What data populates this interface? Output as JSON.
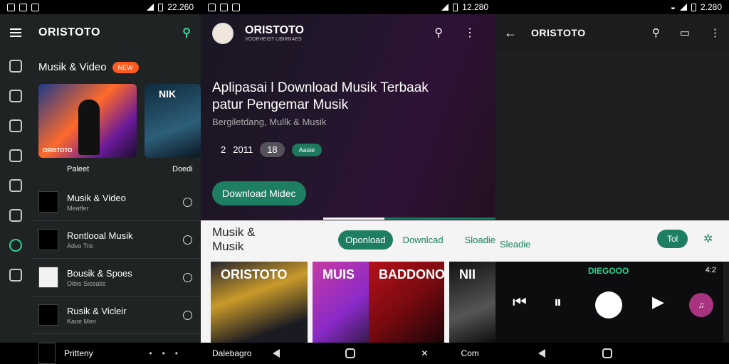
{
  "panel1": {
    "status": {
      "time": "22.260"
    },
    "header": {
      "brand": "ORISTOTO"
    },
    "section": {
      "title": "Musik & Video",
      "badge": "NEW"
    },
    "cards": [
      {
        "caption": "ORISTOTO",
        "under_label": "Paleet"
      },
      {
        "title": "NIK",
        "under_label": "Doedi"
      }
    ],
    "list": [
      {
        "title": "Musik & Video",
        "subtitle": "Meatfer"
      },
      {
        "title": "Rontlooal Musik",
        "subtitle": "Advo Tric"
      },
      {
        "title": "Bousik & Spoes",
        "subtitle": "Oibis Siceatis"
      },
      {
        "title": "Rusik & Vicleir",
        "subtitle": "Kaoe Men"
      }
    ],
    "bottom": {
      "title": "Pritteny"
    }
  },
  "panel2": {
    "status": {
      "time": "12.280"
    },
    "header": {
      "brand": "ORISTOTO",
      "brand_sub": "VOORHEIST LIBIRNAES"
    },
    "hero": {
      "title": "Aplipasai l Download Musik Terbaak patur Pengemar Musik",
      "subtitle": "Bergiletdang, Mullk & Musik",
      "stat1": "2",
      "stat2": "2011",
      "chip_grey": "18",
      "chip_green": "Aasie",
      "button": "Download Midec",
      "progress": 0.35
    },
    "tabs": {
      "title": "Musik & Musik",
      "items": [
        "Oponload",
        "Downlcad",
        "Sloadie"
      ]
    },
    "tiles": [
      "ORISTOTO",
      "MUIS",
      "BADDONO",
      "NII"
    ],
    "bottom": {
      "left": "Dalebagro",
      "right": "Com"
    }
  },
  "panel3": {
    "status": {
      "time": "2.280"
    },
    "header": {
      "brand": "ORISTOTO"
    },
    "tab": "Sleadie",
    "button": "Tol",
    "player": {
      "title": "DIEGOOO",
      "time": "4:2"
    }
  }
}
